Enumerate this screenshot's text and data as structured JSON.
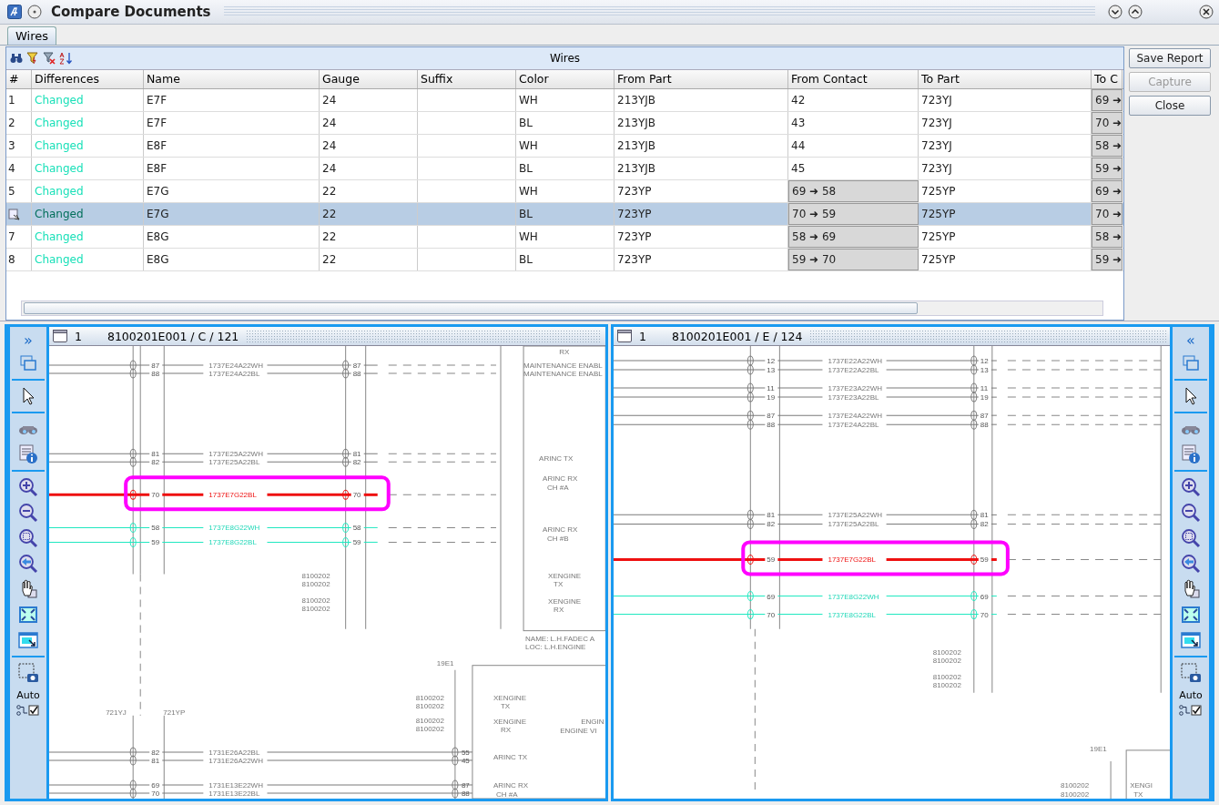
{
  "window": {
    "title": "Compare Documents"
  },
  "tabs": [
    {
      "label": "Wires",
      "selected": true
    }
  ],
  "table": {
    "title": "Wires",
    "columns": [
      "#",
      "Differences",
      "Name",
      "Gauge",
      "Suffix",
      "Color",
      "From Part",
      "From Contact",
      "To Part",
      "To C"
    ],
    "rows": [
      {
        "number": "1",
        "selected": false,
        "difference": "Changed",
        "name": "E7F",
        "gauge": "24",
        "wire_color": "WH",
        "from_part": "213YJB",
        "from_contact": "42",
        "from_contact_changed": false,
        "to_part": "723YJ",
        "to_contact": "69 ➜",
        "to_contact_changed": true
      },
      {
        "number": "2",
        "selected": false,
        "difference": "Changed",
        "name": "E7F",
        "gauge": "24",
        "wire_color": "BL",
        "from_part": "213YJB",
        "from_contact": "43",
        "from_contact_changed": false,
        "to_part": "723YJ",
        "to_contact": "70 ➜",
        "to_contact_changed": true
      },
      {
        "number": "3",
        "selected": false,
        "difference": "Changed",
        "name": "E8F",
        "gauge": "24",
        "wire_color": "WH",
        "from_part": "213YJB",
        "from_contact": "44",
        "from_contact_changed": false,
        "to_part": "723YJ",
        "to_contact": "58 ➜",
        "to_contact_changed": true
      },
      {
        "number": "4",
        "selected": false,
        "difference": "Changed",
        "name": "E8F",
        "gauge": "24",
        "wire_color": "BL",
        "from_part": "213YJB",
        "from_contact": "45",
        "from_contact_changed": false,
        "to_part": "723YJ",
        "to_contact": "59 ➜",
        "to_contact_changed": true
      },
      {
        "number": "5",
        "selected": false,
        "difference": "Changed",
        "name": "E7G",
        "gauge": "22",
        "wire_color": "WH",
        "from_part": "723YP",
        "from_contact": "69 ➜ 58",
        "from_contact_changed": true,
        "to_part": "725YP",
        "to_contact": "69 ➜",
        "to_contact_changed": true
      },
      {
        "selected": true,
        "difference": "Changed",
        "name": "E7G",
        "gauge": "22",
        "wire_color": "BL",
        "from_part": "723YP",
        "from_contact": "70 ➜ 59",
        "from_contact_changed": true,
        "to_part": "725YP",
        "to_contact": "70 ➜",
        "to_contact_changed": true
      },
      {
        "number": "7",
        "selected": false,
        "difference": "Changed",
        "name": "E8G",
        "gauge": "22",
        "wire_color": "WH",
        "from_part": "723YP",
        "from_contact": "58 ➜ 69",
        "from_contact_changed": true,
        "to_part": "725YP",
        "to_contact": "58 ➜",
        "to_contact_changed": true
      },
      {
        "number": "8",
        "selected": false,
        "difference": "Changed",
        "name": "E8G",
        "gauge": "22",
        "wire_color": "BL",
        "from_part": "723YP",
        "from_contact": "59 ➜ 70",
        "from_contact_changed": true,
        "to_part": "725YP",
        "to_contact": "59 ➜",
        "to_contact_changed": true
      }
    ]
  },
  "buttons": [
    {
      "label": "Save Report",
      "disabled": false
    },
    {
      "label": "Capture",
      "disabled": true
    },
    {
      "label": "Close",
      "disabled": false
    }
  ],
  "panels": [
    {
      "number": "1",
      "title": "8100201E001 / C / 121",
      "toggle": "»",
      "auto_label": "Auto",
      "auto_checked": true,
      "wires": [
        {
          "pin_a": "87",
          "label": "1737E24A22WH",
          "pin_b": "87",
          "kind": "normal"
        },
        {
          "pin_a": "88",
          "label": "1737E24A22BL",
          "pin_b": "88",
          "kind": "normal"
        },
        {
          "pin_a": "81",
          "label": "1737E25A22WH",
          "pin_b": "81",
          "kind": "normal"
        },
        {
          "pin_a": "82",
          "label": "1737E25A22BL",
          "pin_b": "82",
          "kind": "normal"
        },
        {
          "pin_a": "70",
          "label": "1737E7G22BL",
          "pin_b": "70",
          "kind": "selected"
        },
        {
          "pin_a": "58",
          "label": "1737E8G22WH",
          "pin_b": "58",
          "kind": "changed"
        },
        {
          "pin_a": "59",
          "label": "1737E8G22BL",
          "pin_b": "59",
          "kind": "changed"
        },
        {
          "pin_a": "82",
          "label": "1731E26A22BL",
          "pin_b": "55",
          "kind": "normal"
        },
        {
          "pin_a": "81",
          "label": "1731E26A22WH",
          "pin_b": "45",
          "kind": "normal"
        },
        {
          "pin_a": "69",
          "label": "1731E13E22WH",
          "pin_b": "87",
          "kind": "normal"
        },
        {
          "pin_a": "70",
          "label": "1731E13E22BL",
          "pin_b": "88",
          "kind": "normal"
        }
      ],
      "labels": [
        "RX",
        "MAINTENANCE ENABL",
        "MAINTENANCE ENABL",
        "ARINC TX",
        "ARINC RX",
        "CH #A",
        "ARINC RX",
        "CH #B",
        "XENGINE",
        "TX",
        "XENGINE",
        "RX",
        "8100202",
        "8100202",
        "8100202",
        "8100202",
        "NAME: L.H.FADEC A",
        "LOC: L.H.ENGINE",
        "19E1",
        "8100202",
        "8100202",
        "8100202",
        "8100202",
        "XENGINE",
        "TX",
        "XENGINE",
        "RX",
        "ENGIN",
        "ENGINE VI",
        "721YJ",
        "721YP",
        "ARINC TX",
        "ARINC RX",
        "CH #A"
      ]
    },
    {
      "number": "1",
      "title": "8100201E001 / E / 124",
      "toggle": "«",
      "auto_label": "Auto",
      "auto_checked": true,
      "wires": [
        {
          "pin_a": "12",
          "label": "1737E22A22WH",
          "pin_b": "12",
          "kind": "normal"
        },
        {
          "pin_a": "13",
          "label": "1737E22A22BL",
          "pin_b": "13",
          "kind": "normal"
        },
        {
          "pin_a": "11",
          "label": "1737E23A22WH",
          "pin_b": "11",
          "kind": "normal"
        },
        {
          "pin_a": "19",
          "label": "1737E23A22BL",
          "pin_b": "19",
          "kind": "normal"
        },
        {
          "pin_a": "87",
          "label": "1737E24A22WH",
          "pin_b": "87",
          "kind": "normal"
        },
        {
          "pin_a": "88",
          "label": "1737E24A22BL",
          "pin_b": "88",
          "kind": "normal"
        },
        {
          "pin_a": "81",
          "label": "1737E25A22WH",
          "pin_b": "81",
          "kind": "normal"
        },
        {
          "pin_a": "82",
          "label": "1737E25A22BL",
          "pin_b": "82",
          "kind": "normal"
        },
        {
          "pin_a": "59",
          "label": "1737E7G22BL",
          "pin_b": "59",
          "kind": "selected"
        },
        {
          "pin_a": "69",
          "label": "1737E8G22WH",
          "pin_b": "69",
          "kind": "changed"
        },
        {
          "pin_a": "70",
          "label": "1737E8G22BL",
          "pin_b": "70",
          "kind": "changed"
        }
      ],
      "labels": [
        "8100202",
        "8100202",
        "8100202",
        "8100202",
        "19E1",
        "8100202",
        "8100202",
        "XENGI",
        "TX"
      ]
    }
  ]
}
